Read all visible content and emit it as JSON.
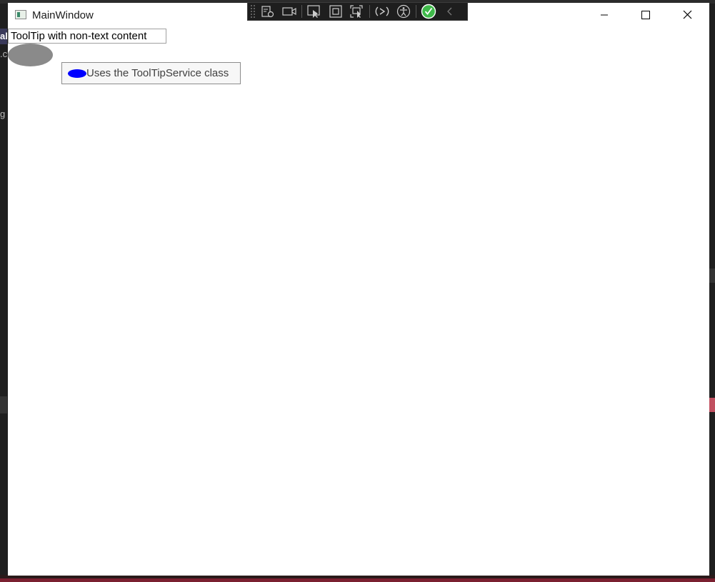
{
  "window": {
    "title": "MainWindow",
    "caption_buttons": [
      "minimize-icon",
      "maximize-icon",
      "close-icon"
    ]
  },
  "debug_toolbar": {
    "icons": [
      "live-visual-tree-icon",
      "record-icon",
      "select-element-icon",
      "display-layout-adorners-icon",
      "track-focus-icon",
      "hot-reload-icon",
      "accessibility-icon",
      "binding-check-icon",
      "collapse-chevron-icon"
    ],
    "status_color": "#3fb94a"
  },
  "content": {
    "label": "ToolTip with non-text content",
    "tooltip_text": "Uses the ToolTipService class"
  },
  "colors": {
    "gray_ellipse": "#8a8a8a",
    "blue_ellipse": "#0000ff"
  }
}
